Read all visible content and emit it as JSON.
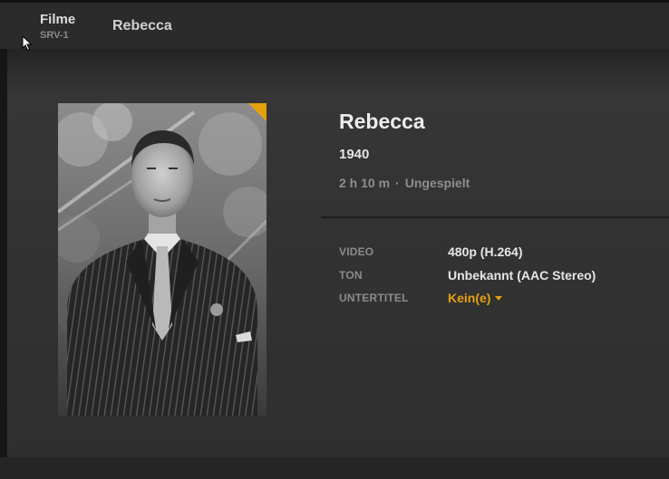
{
  "breadcrumb": {
    "section": "Filme",
    "server": "SRV-1",
    "current": "Rebecca"
  },
  "movie": {
    "title": "Rebecca",
    "year": "1940",
    "duration": "2 h 10 m",
    "separator": "·",
    "status": "Ungespielt"
  },
  "details": {
    "video_label": "VIDEO",
    "video_value": "480p (H.264)",
    "audio_label": "TON",
    "audio_value": "Unbekannt (AAC Stereo)",
    "subtitle_label": "UNTERTITEL",
    "subtitle_value": "Kein(e)"
  },
  "colors": {
    "accent": "#e5a00d",
    "background": "#333333",
    "text": "#ececec",
    "muted": "#8e8e8e"
  },
  "icons": {
    "pointer": "mouse-cursor-icon",
    "dropdown": "caret-down-icon",
    "poster_flag": "unwatched-corner-icon"
  }
}
